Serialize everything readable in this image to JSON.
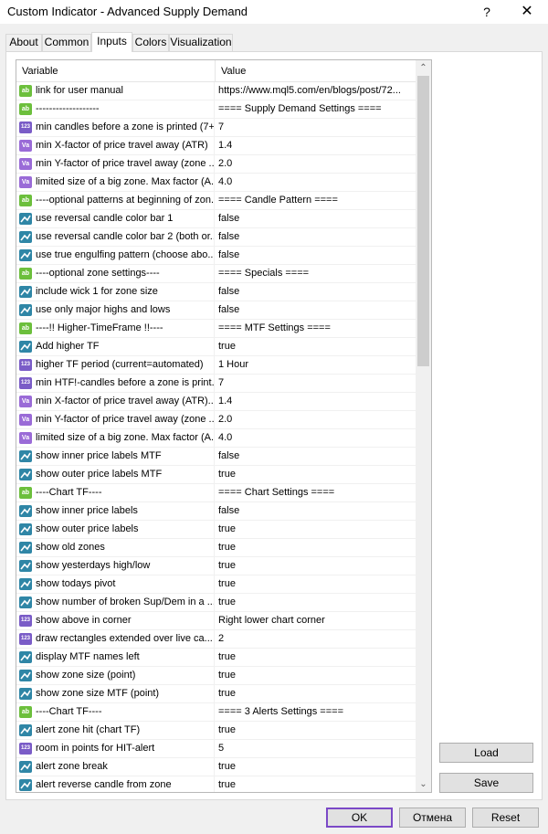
{
  "window": {
    "title": "Custom Indicator - Advanced Supply Demand",
    "help_glyph": "?",
    "close_glyph": "✕"
  },
  "tabs": [
    {
      "label": "About"
    },
    {
      "label": "Common"
    },
    {
      "label": "Inputs"
    },
    {
      "label": "Colors"
    },
    {
      "label": "Visualization"
    }
  ],
  "active_tab": "Inputs",
  "grid": {
    "header_variable": "Variable",
    "header_value": "Value",
    "rows": [
      {
        "type": "ab",
        "name": "link for user manual",
        "value": "https://www.mql5.com/en/blogs/post/72..."
      },
      {
        "type": "ab",
        "name": "-------------------",
        "value": "==== Supply Demand Settings ====",
        "group": true
      },
      {
        "type": "123",
        "name": "min candles before a zone is printed (7+)",
        "value": "7"
      },
      {
        "type": "dbl",
        "name": "min X-factor of price travel away (ATR)",
        "value": "1.4"
      },
      {
        "type": "dbl",
        "name": "min Y-factor of price travel away (zone ...",
        "value": "2.0"
      },
      {
        "type": "dbl",
        "name": "limited size of a big zone. Max factor (A...",
        "value": "4.0"
      },
      {
        "type": "ab",
        "name": "----optional patterns at beginning of zon...",
        "value": "==== Candle Pattern ===="
      },
      {
        "type": "bool",
        "name": "use reversal candle color bar 1",
        "value": "false"
      },
      {
        "type": "bool",
        "name": "use reversal candle color bar 2 (both or...",
        "value": "false"
      },
      {
        "type": "bool",
        "name": "use true engulfing pattern (choose abo...",
        "value": "false"
      },
      {
        "type": "ab",
        "name": "----optional zone settings----",
        "value": "==== Specials ===="
      },
      {
        "type": "bool",
        "name": "include wick 1 for zone size",
        "value": "false"
      },
      {
        "type": "bool",
        "name": "use only major highs and lows",
        "value": "false"
      },
      {
        "type": "ab",
        "name": "----!! Higher-TimeFrame !!----",
        "value": "==== MTF Settings ===="
      },
      {
        "type": "bool",
        "name": "Add higher TF",
        "value": "true"
      },
      {
        "type": "123",
        "name": "higher TF period (current=automated)",
        "value": "1 Hour"
      },
      {
        "type": "123",
        "name": "min HTF!-candles before a zone is print...",
        "value": "7"
      },
      {
        "type": "dbl",
        "name": "min X-factor of price travel away (ATR)...",
        "value": "1.4"
      },
      {
        "type": "dbl",
        "name": "min Y-factor of price travel away (zone ...",
        "value": "2.0"
      },
      {
        "type": "dbl",
        "name": "limited size of a big zone. Max factor (A...",
        "value": "4.0"
      },
      {
        "type": "bool",
        "name": "show inner price labels MTF",
        "value": "false"
      },
      {
        "type": "bool",
        "name": "show outer price labels MTF",
        "value": "true"
      },
      {
        "type": "ab",
        "name": "----Chart  TF----",
        "value": "==== Chart Settings ===="
      },
      {
        "type": "bool",
        "name": "show inner price labels",
        "value": "false"
      },
      {
        "type": "bool",
        "name": "show outer price labels",
        "value": "true"
      },
      {
        "type": "bool",
        "name": "show old zones",
        "value": "true"
      },
      {
        "type": "bool",
        "name": "show yesterdays high/low",
        "value": "true"
      },
      {
        "type": "bool",
        "name": "show todays pivot",
        "value": "true"
      },
      {
        "type": "bool",
        "name": "show number of broken Sup/Dem in a ...",
        "value": "true"
      },
      {
        "type": "123",
        "name": "show above in corner",
        "value": "Right lower chart corner"
      },
      {
        "type": "123",
        "name": "draw rectangles extended over live ca...",
        "value": "2"
      },
      {
        "type": "bool",
        "name": "display MTF names left",
        "value": "true"
      },
      {
        "type": "bool",
        "name": "show zone size (point)",
        "value": "true"
      },
      {
        "type": "bool",
        "name": "show zone size MTF (point)",
        "value": "true"
      },
      {
        "type": "ab",
        "name": "----Chart  TF----",
        "value": "==== 3 Alerts Settings ===="
      },
      {
        "type": "bool",
        "name": "alert zone hit (chart TF)",
        "value": "true"
      },
      {
        "type": "123",
        "name": "room in points for HIT-alert",
        "value": "5"
      },
      {
        "type": "bool",
        "name": "alert zone break",
        "value": "true"
      },
      {
        "type": "bool",
        "name": "alert reverse candle from zone",
        "value": "true"
      }
    ]
  },
  "scrollbar": {
    "up_glyph": "⌃",
    "down_glyph": "⌄"
  },
  "buttons": {
    "load": "Load",
    "save": "Save",
    "ok": "OK",
    "cancel": "Отмена",
    "reset": "Reset"
  }
}
